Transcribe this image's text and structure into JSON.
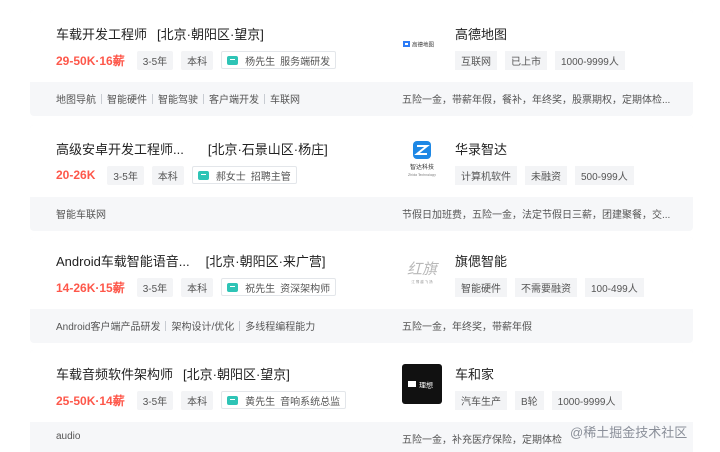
{
  "jobs": [
    {
      "title": "车载开发工程师",
      "area": "[北京·朝阳区·望京]",
      "salary": "29-50K·16薪",
      "exp": "3-5年",
      "degree": "本科",
      "recruiter_name": "杨先生",
      "recruiter_role": "服务端研发",
      "company": "高德地图",
      "company_tags": [
        "互联网",
        "已上市",
        "1000-9999人"
      ],
      "skills": [
        "地图导航",
        "智能硬件",
        "智能驾驶",
        "客户端开发",
        "车联网"
      ],
      "benefits": "五险一金，带薪年假，餐补，年终奖，股票期权，定期体检...",
      "logo_text": "高德地图"
    },
    {
      "title": "高级安卓开发工程师...",
      "area": "[北京·石景山区·杨庄]",
      "salary": "20-26K",
      "exp": "3-5年",
      "degree": "本科",
      "recruiter_name": "郝女士",
      "recruiter_role": "招聘主管",
      "company": "华录智达",
      "company_tags": [
        "计算机软件",
        "未融资",
        "500-999人"
      ],
      "skills": [
        "智能车联网"
      ],
      "benefits": "节假日加班费，五险一金，法定节假日三薪，团建聚餐，交...",
      "logo_text": "智达科技",
      "logo_sub": "Zhida Technology"
    },
    {
      "title": "Android车载智能语音...",
      "area": "[北京·朝阳区·来广营]",
      "salary": "14-26K·15薪",
      "exp": "3-5年",
      "degree": "本科",
      "recruiter_name": "祝先生",
      "recruiter_role": "资深架构师",
      "company": "旗偲智能",
      "company_tags": [
        "智能硬件",
        "不需要融资",
        "100-499人"
      ],
      "skills": [
        "Android客户端产品研发",
        "架构设计/优化",
        "多线程编程能力"
      ],
      "benefits": "五险一金，年终奖，带薪年假",
      "logo_text": "红旗",
      "logo_sub": "江 骞 越 飞 扬"
    },
    {
      "title": "车载音频软件架构师",
      "area": "[北京·朝阳区·望京]",
      "salary": "25-50K·14薪",
      "exp": "3-5年",
      "degree": "本科",
      "recruiter_name": "黄先生",
      "recruiter_role": "音响系统总监",
      "company": "车和家",
      "company_tags": [
        "汽车生产",
        "B轮",
        "1000-9999人"
      ],
      "skills": [
        "audio"
      ],
      "benefits": "五险一金，补充医疗保险，定期体检",
      "logo_text": "理想"
    }
  ],
  "watermark": "@稀土掘金技术社区",
  "colors": {
    "salary": "#fe574a",
    "chat_icon": "#2ec4b6",
    "card_bottom": "#f6f7f9"
  }
}
